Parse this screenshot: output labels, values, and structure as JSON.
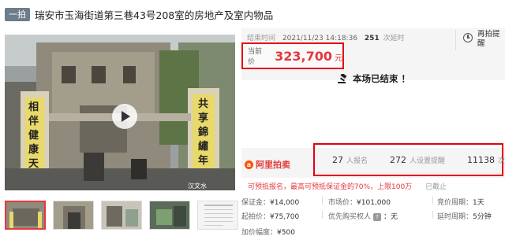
{
  "header": {
    "round_tag": "一拍",
    "title": "瑞安市玉海街道第三巷43号208室的房地产及室内物品"
  },
  "auction": {
    "end_label": "结束时间",
    "end_time": "2021/11/23 14:18:36",
    "delay_count": "251",
    "delay_label": "次延时",
    "current_price_label": "当前价",
    "current_price": "323,700",
    "currency_unit": "元",
    "ended_message": "本场已结束 ！",
    "remind_label": "再拍提醒"
  },
  "platform": {
    "logo_text": "阿里拍卖"
  },
  "stats": {
    "registered_count": "27",
    "registered_label": "人报名",
    "reminders_count": "272",
    "reminders_label": "人设置提醒",
    "views_count": "11138",
    "views_label": "次围观"
  },
  "notice": {
    "text": "可预抵报名，最高可预抵保证金的70%，上限100万",
    "closed": "已截止"
  },
  "details": {
    "deposit_label": "保证金：",
    "deposit": "¥14,000",
    "market_price_label": "市场价：",
    "market_price": "¥101,000",
    "bid_period_label": "竞价周期：",
    "bid_period": "1天",
    "start_price_label": "起拍价：",
    "start_price": "¥75,700",
    "priority_label": "优先购买权人",
    "priority_badge": "?",
    "priority_value": "：无",
    "delay_period_label": "延时周期：",
    "delay_period": "5分钟",
    "increment_label": "加价幅度：",
    "increment": "¥500"
  },
  "photo": {
    "banner_left": "相伴健康天",
    "banner_right": "共享錦繡年",
    "watermark": "汉文水"
  },
  "colors": {
    "accent_red": "#e4393c",
    "box_red": "#e60012",
    "tag_grey": "#6c7d8c"
  }
}
